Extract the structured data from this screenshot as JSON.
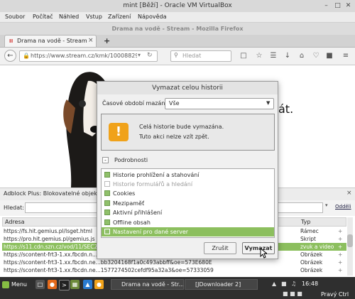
{
  "vbox": {
    "title": "mint [Běží] - Oracle VM VirtualBox",
    "menu": [
      "Soubor",
      "Počítač",
      "Náhled",
      "Vstup",
      "Zařízení",
      "Nápověda"
    ]
  },
  "firefox": {
    "window_title": "Drama na vodě - Stream - Mozilla Firefox",
    "tab_title": "Drama na vodě - Stream",
    "url": "https://www.stream.cz/kmk/10008829-dra",
    "search_placeholder": "Hledat",
    "page_text_fragment": "át."
  },
  "adblock": {
    "panel_title": "Adblock Plus: Blokovatelné objekty na",
    "filter_label": "Hledat:",
    "close_link": "Odděli",
    "col_address": "Adresa",
    "col_type": "Typ",
    "rows": [
      {
        "addr": "https://fs.hit.gemius.pl/lsget.html",
        "type": "Rámec",
        "selected": false
      },
      {
        "addr": "https://pro.hit.gemius.pl/gemius.js",
        "type": "Skript",
        "selected": false
      },
      {
        "addr": "https://s11.cdn.szn.cz/vod/11/SEC2...",
        "type": "zvuk a video",
        "selected": true
      },
      {
        "addr": "https://scontent-frt3-1.xx.fbcdn.n...307",
        "type": "Obrázek",
        "selected": false
      },
      {
        "addr": "https://scontent-frt3-1.xx.fbcdn.ne...bb3204168f1a0c493abbff&oe=573E680E",
        "type": "Obrázek",
        "selected": false
      },
      {
        "addr": "https://scontent-frt3-1.xx.fbcdn.ne...1577274502cefdf95a32a3&oe=57333059",
        "type": "Obrázek",
        "selected": false
      }
    ]
  },
  "dialog": {
    "title": "Vymazat celou historii",
    "period_label": "Časové období mazání:",
    "period_value": "Vše",
    "message_line1": "Celá historie bude vymazána.",
    "message_line2": "Tuto akci nelze vzít zpět.",
    "details_label": "Podrobnosti",
    "items": [
      {
        "label": "Historie prohlížení a stahování",
        "checked": true
      },
      {
        "label": "Historie formulářů a hledání",
        "checked": false
      },
      {
        "label": "Cookies",
        "checked": true
      },
      {
        "label": "Mezipaměť",
        "checked": true
      },
      {
        "label": "Aktivní přihlášení",
        "checked": true
      },
      {
        "label": "Offline obsah",
        "checked": true
      },
      {
        "label": "Nastavení pro dané server",
        "checked": true
      }
    ],
    "cancel_label": "Zrušit",
    "confirm_label": "Vymazat"
  },
  "taskbar": {
    "menu_label": "Menu",
    "window1": "Drama na vodě - Str...",
    "window2": "[JDownloader 2]",
    "clock": "16:48",
    "right_ctrl": "Pravý Ctrl"
  },
  "colors": {
    "accent_green": "#8cbf5e",
    "warning_orange": "#f0a21a",
    "taskbar": "#2f2f2f"
  }
}
